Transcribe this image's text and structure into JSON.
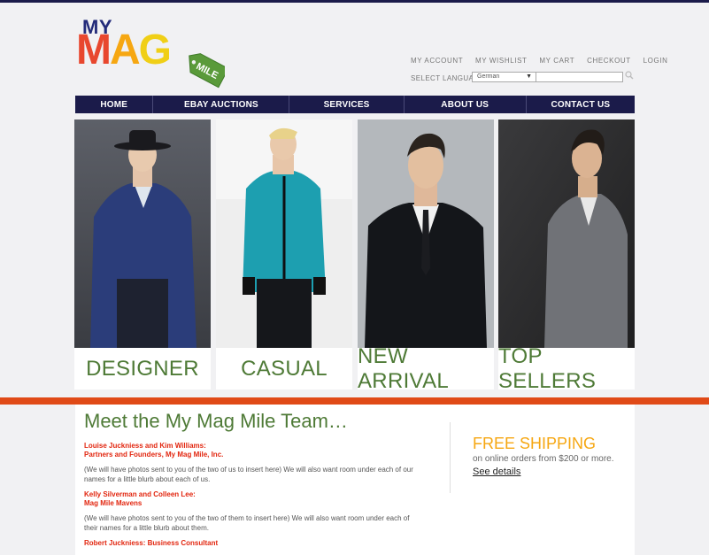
{
  "logo": {
    "my": "MY",
    "mag_m": "M",
    "mag_a": "A",
    "mag_g": "G",
    "mile": "MILE"
  },
  "utility_links": [
    "MY ACCOUNT",
    "MY WISHLIST",
    "MY CART",
    "CHECKOUT",
    "LOGIN"
  ],
  "language": {
    "label": "SELECT LANGUAGE",
    "selected": "German"
  },
  "nav": [
    "HOME",
    "EBAY AUCTIONS",
    "SERVICES",
    "ABOUT US",
    "CONTACT US"
  ],
  "categories": [
    "DESIGNER",
    "CASUAL",
    "NEW ARRIVAL",
    "TOP SELLERS"
  ],
  "team": {
    "title": "Meet the My Mag Mile Team…",
    "members": [
      {
        "names": "Louise Juckniess and Kim Williams:",
        "role": "Partners and Founders, My Mag Mile, Inc.",
        "blurb_line1": "(We will have photos sent to you of the two of us to insert here)  We will also want room under each of our",
        "blurb_line2": "names for a little blurb about each of us."
      },
      {
        "names": "Kelly Silverman and Colleen Lee:",
        "role": "Mag Mile Mavens",
        "blurb_line1": "(We will have photos sent to you of the two of them to insert here) We will also want room under each of",
        "blurb_line2": "their names for a little blurb about them."
      },
      {
        "names": "Robert Juckniess:  Business Consultant"
      }
    ]
  },
  "shipping": {
    "title": "FREE SHIPPING",
    "subtitle": "on online orders from $200 or more.",
    "link": "See details"
  },
  "colors": {
    "navy": "#1b1b4a",
    "green": "#4e7a36",
    "orange": "#e04a17",
    "red": "#e2260f",
    "gold": "#f6a712"
  }
}
